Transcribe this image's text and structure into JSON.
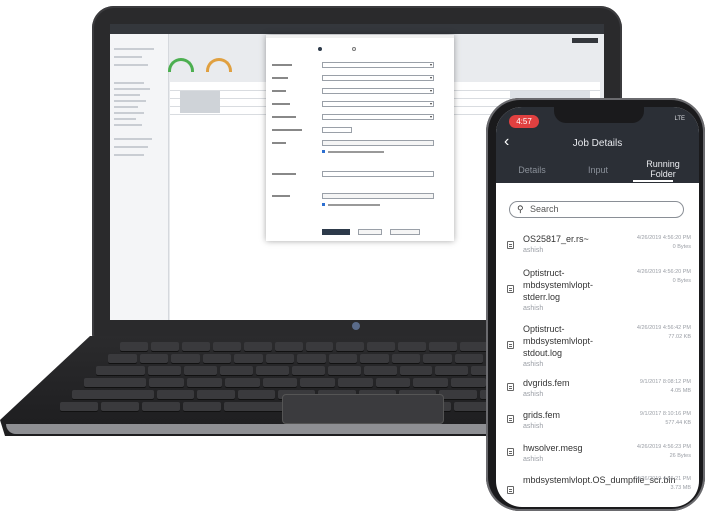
{
  "colors": {
    "phone_header": "#2b2f36",
    "time_badge": "#e04040",
    "dialog_primary": "#2d3a4a",
    "gauge": "#4caf50"
  },
  "phone": {
    "status": {
      "time": "4:57",
      "network": "LTE"
    },
    "title": "Job Details",
    "tabs": [
      {
        "label": "Details"
      },
      {
        "label": "Input"
      },
      {
        "label": "Running Folder"
      }
    ],
    "search": {
      "placeholder": "Search",
      "icon": "search-icon"
    },
    "files": [
      {
        "name": "OS25817_er.rs~",
        "user": "ashish",
        "date": "4/26/2019 4:56:20 PM",
        "size": "0 Bytes"
      },
      {
        "name": "Optistruct-mbdsystemlvlopt-stderr.log",
        "user": "ashish",
        "date": "4/26/2019 4:56:20 PM",
        "size": "0 Bytes"
      },
      {
        "name": "Optistruct-mbdsystemlvlopt-stdout.log",
        "user": "ashish",
        "date": "4/26/2019 4:56:42 PM",
        "size": "77.02 KB"
      },
      {
        "name": "dvgrids.fem",
        "user": "ashish",
        "date": "9/1/2017 8:08:12 PM",
        "size": "4.05 MB"
      },
      {
        "name": "grids.fem",
        "user": "ashish",
        "date": "9/1/2017 8:10:16 PM",
        "size": "577.44 KB"
      },
      {
        "name": "hwsolver.mesg",
        "user": "ashish",
        "date": "4/26/2019 4:56:23 PM",
        "size": "26 Bytes"
      },
      {
        "name": "mbdsystemlvlopt.OS_dumpfile_scr.bin",
        "user": "",
        "date": "4/26/2019 4:56:21 PM",
        "size": "3.73 MB"
      }
    ]
  }
}
